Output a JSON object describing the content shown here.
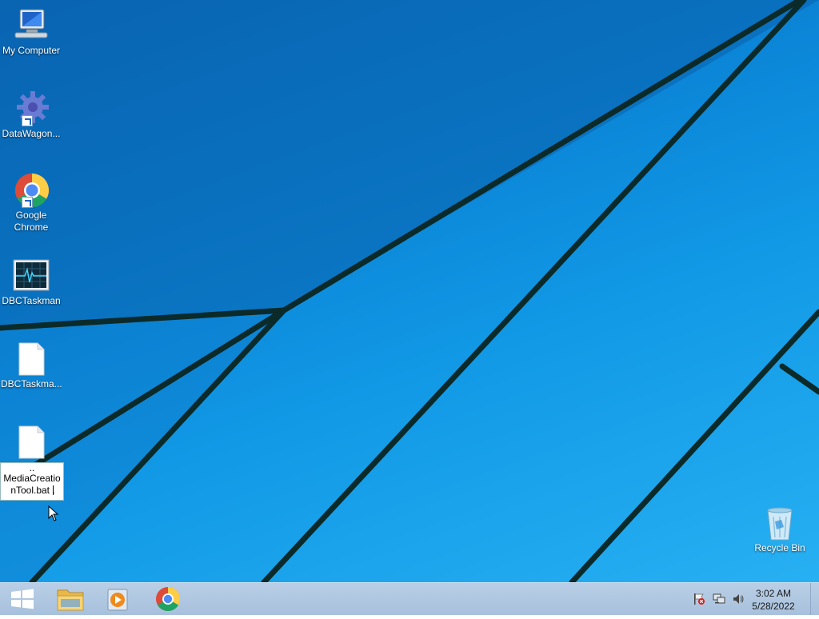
{
  "desktop": {
    "icons": [
      {
        "label": "My Computer"
      },
      {
        "label": "DataWagon..."
      },
      {
        "label": "Google Chrome"
      },
      {
        "label": "DBCTaskman"
      },
      {
        "label": "DBCTaskma..."
      },
      {
        "label": "Recycle Bin"
      }
    ],
    "rename": {
      "line1": "..",
      "line2": "MediaCreatio",
      "line3": "nTool.bat ."
    }
  },
  "taskbar": {
    "pinned": [
      "windows-start-icon",
      "file-explorer-icon",
      "media-player-icon",
      "chrome-icon"
    ],
    "tray_icons": [
      "action-center-flag-icon",
      "network-icon",
      "volume-icon"
    ],
    "clock": {
      "time": "3:02 AM",
      "date": "5/28/2022"
    }
  },
  "colors": {
    "wallpaper_blue": "#1199e6",
    "taskbar": "#b2c9e2"
  }
}
